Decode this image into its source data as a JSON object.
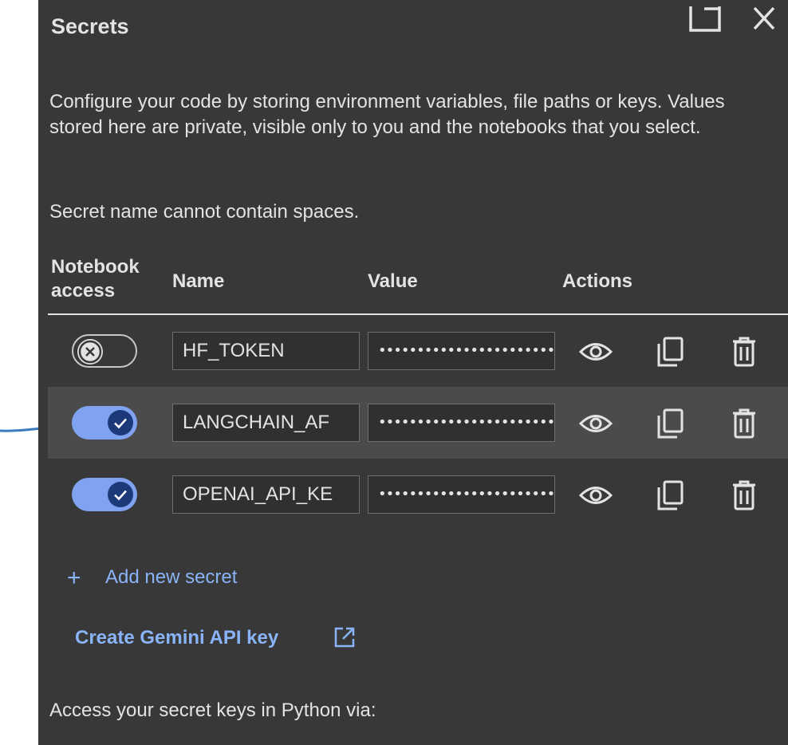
{
  "header": {
    "title": "Secrets"
  },
  "description": "Configure your code by storing environment variables, file paths or keys. Values stored here are private, visible only to you and the notebooks that you select.",
  "note": "Secret name cannot contain spaces.",
  "table": {
    "headers": {
      "access_line1": "Notebook",
      "access_line2": "access",
      "name": "Name",
      "value": "Value",
      "actions": "Actions"
    },
    "rows": [
      {
        "access": false,
        "name": "HF_TOKEN",
        "value": "••••••••••••••••••••••••"
      },
      {
        "access": true,
        "name": "LANGCHAIN_AF",
        "value": "••••••••••••••••••••••••"
      },
      {
        "access": true,
        "name": "OPENAI_API_KE",
        "value": "••••••••••••••••••••••••"
      }
    ],
    "action_icons": [
      "eye-icon",
      "copy-icon",
      "trash-icon"
    ]
  },
  "add_secret_label": "Add new secret",
  "create_key_label": "Create Gemini API key",
  "footer": "Access your secret keys in Python via:",
  "colors": {
    "panel_bg": "#383838",
    "accent": "#8ab4f8",
    "toggle_on": "#7fa3f0",
    "knob_on": "#1c3a7a",
    "arrow": "#3b7bbf"
  }
}
